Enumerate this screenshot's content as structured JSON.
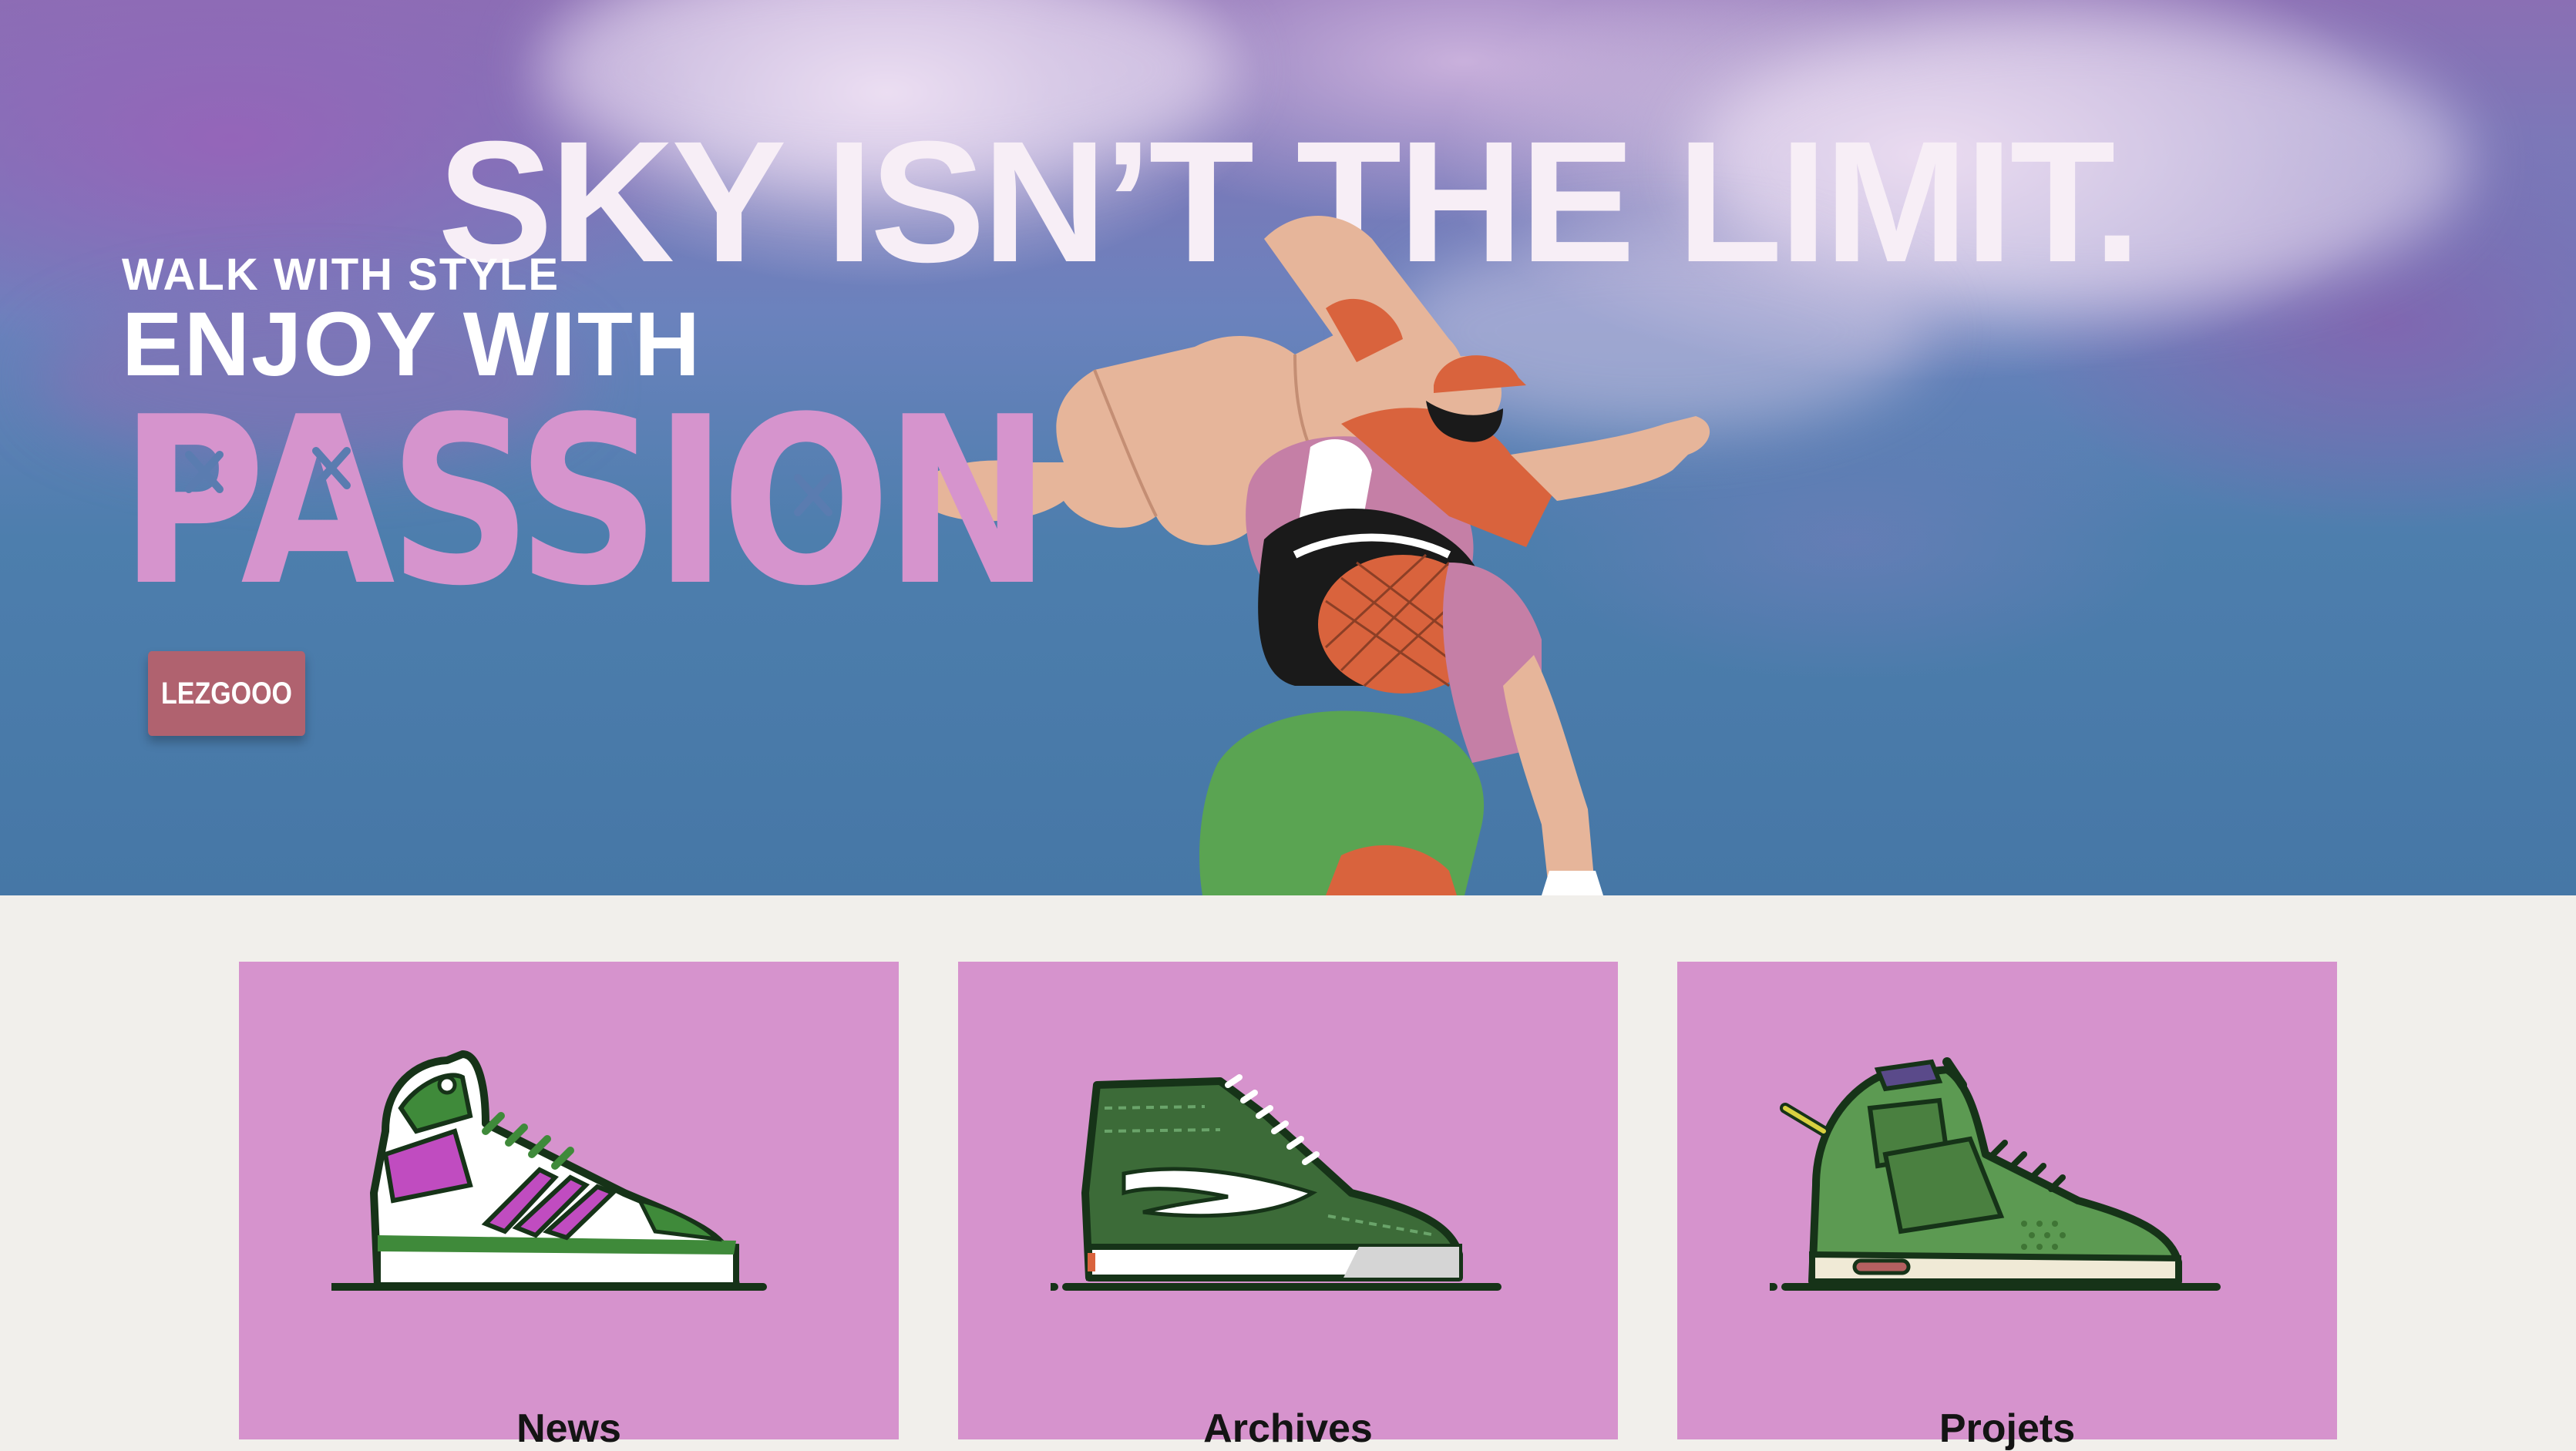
{
  "hero": {
    "headline": "SKY ISN’T THE LIMIT.",
    "tagline": "WALK WITH STYLE",
    "subheadline": "ENJOY WITH",
    "accent_word": "PASSION",
    "cta_label": "LEZGOOO",
    "colors": {
      "headline": "#f7eef6",
      "accent": "#d694cd",
      "cta": "#b0626f",
      "sky": "#4677a6"
    }
  },
  "cards": [
    {
      "label": "News",
      "icon": "high-top-sneaker-icon"
    },
    {
      "label": "Archives",
      "icon": "skate-sneaker-icon"
    },
    {
      "label": "Projets",
      "icon": "cargo-sneaker-icon"
    }
  ],
  "colors": {
    "card_bg": "#d693cd",
    "page_bg": "#f1efeb",
    "shoe_green": "#3f7d3a"
  }
}
